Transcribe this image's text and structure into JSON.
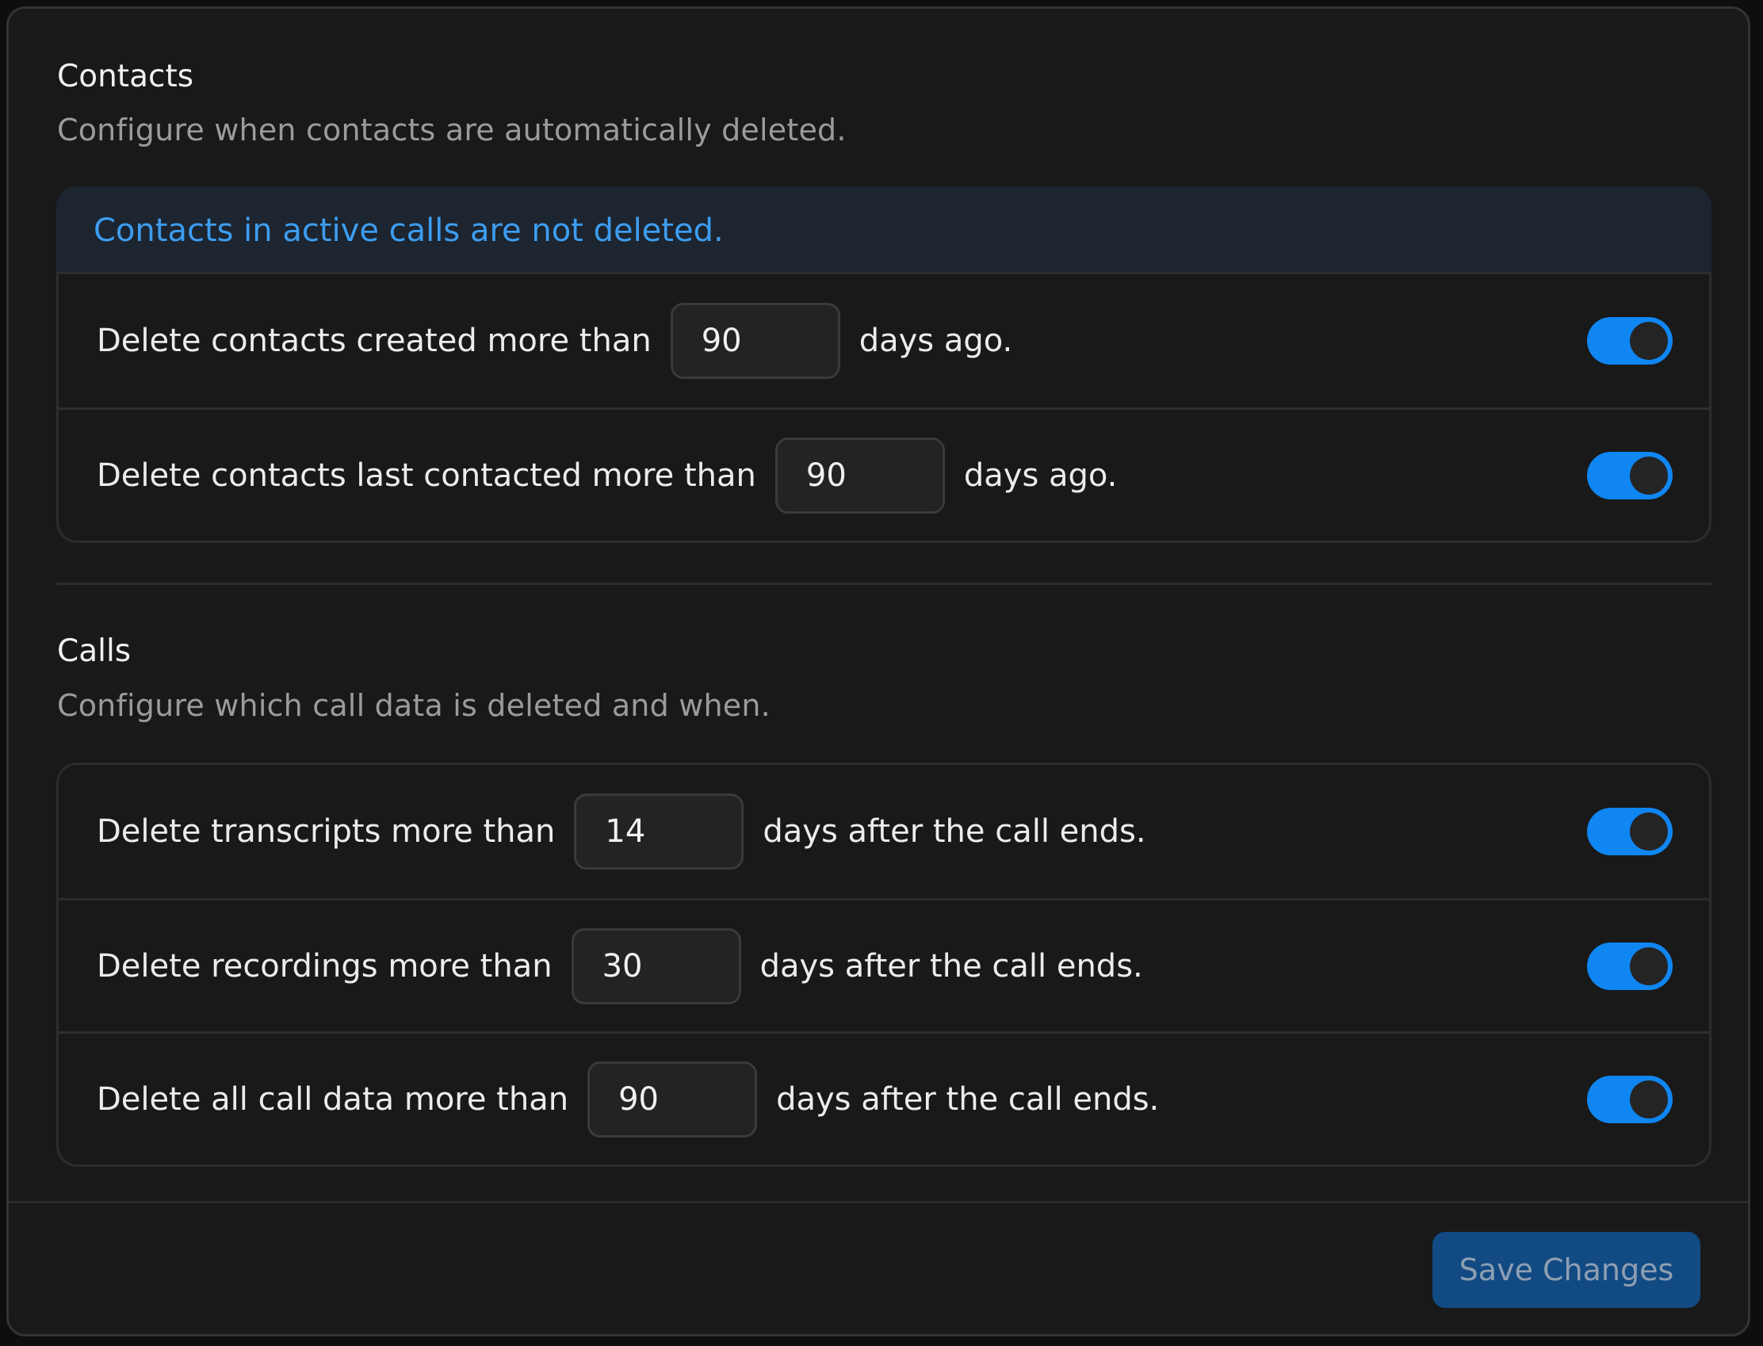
{
  "contacts": {
    "title": "Contacts",
    "description": "Configure when contacts are automatically deleted.",
    "notice": "Contacts in active calls are not deleted.",
    "rules": [
      {
        "label": "Delete contacts created more than",
        "value": "90",
        "suffix": "days ago.",
        "enabled": true
      },
      {
        "label": "Delete contacts last contacted more than",
        "value": "90",
        "suffix": "days ago.",
        "enabled": true
      }
    ]
  },
  "calls": {
    "title": "Calls",
    "description": "Configure which call data is deleted and when.",
    "rules": [
      {
        "label": "Delete transcripts more than",
        "value": "14",
        "suffix": "days after the call ends.",
        "enabled": true
      },
      {
        "label": "Delete recordings more than",
        "value": "30",
        "suffix": "days after the call ends.",
        "enabled": true
      },
      {
        "label": "Delete all call data more than",
        "value": "90",
        "suffix": "days after the call ends.",
        "enabled": true
      }
    ]
  },
  "footer": {
    "save_label": "Save Changes"
  },
  "colors": {
    "accent": "#0f86f2",
    "notice_text": "#3d9df0",
    "save_button_bg": "#124a83"
  }
}
